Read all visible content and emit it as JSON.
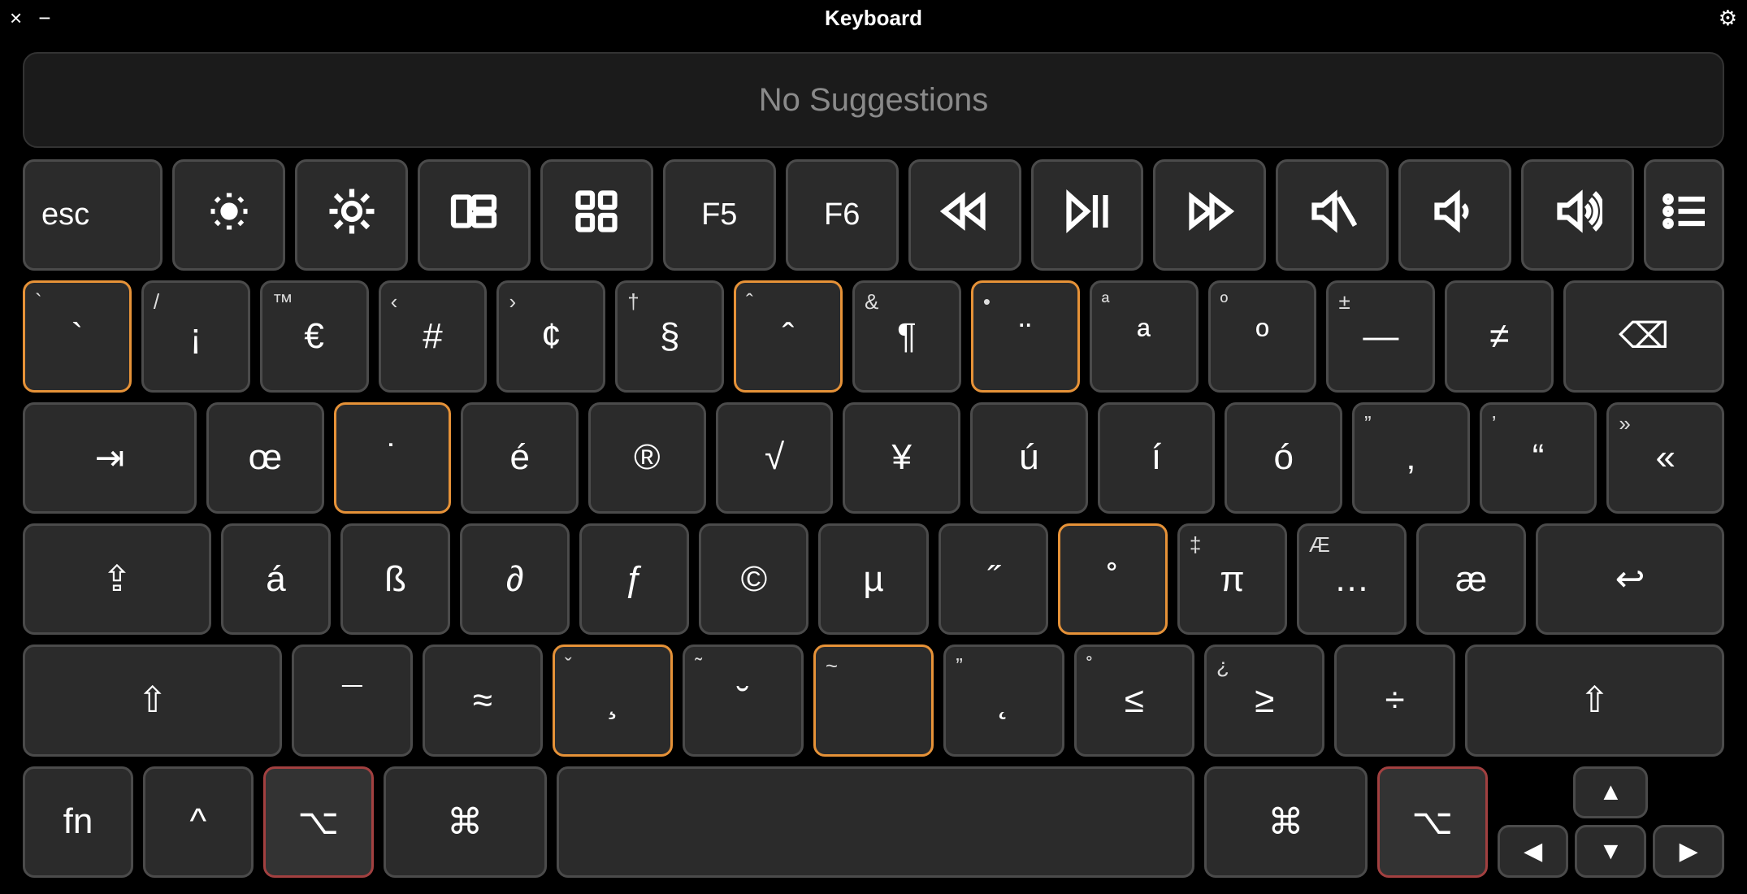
{
  "titlebar": {
    "close": "×",
    "minimize": "−",
    "title": "Keyboard",
    "settings": "⚙"
  },
  "suggestions_text": "No Suggestions",
  "fn_row": [
    {
      "id": "esc",
      "label": "esc",
      "icon": null
    },
    {
      "id": "brightness-down",
      "label": "",
      "icon": "brightness-low"
    },
    {
      "id": "brightness-up",
      "label": "",
      "icon": "brightness-high"
    },
    {
      "id": "mission-control",
      "label": "",
      "icon": "mission-control"
    },
    {
      "id": "launchpad",
      "label": "",
      "icon": "launchpad"
    },
    {
      "id": "f5",
      "label": "F5",
      "icon": null
    },
    {
      "id": "f6",
      "label": "F6",
      "icon": null
    },
    {
      "id": "rewind",
      "label": "",
      "icon": "rewind"
    },
    {
      "id": "play-pause",
      "label": "",
      "icon": "play-pause"
    },
    {
      "id": "fast-forward",
      "label": "",
      "icon": "fast-forward"
    },
    {
      "id": "mute",
      "label": "",
      "icon": "mute"
    },
    {
      "id": "volume-down",
      "label": "",
      "icon": "vol-low"
    },
    {
      "id": "volume-up",
      "label": "",
      "icon": "vol-high"
    },
    {
      "id": "list",
      "label": "",
      "icon": "list"
    }
  ],
  "row1": [
    {
      "id": "backtick",
      "c": "`",
      "tl": "`",
      "hl": "orange"
    },
    {
      "id": "inv-excl",
      "c": "¡",
      "tl": "/"
    },
    {
      "id": "euro",
      "c": "€",
      "tl": "™"
    },
    {
      "id": "hash",
      "c": "#",
      "tl": "‹"
    },
    {
      "id": "cent",
      "c": "¢",
      "tl": "›"
    },
    {
      "id": "section",
      "c": "§",
      "tl": "†"
    },
    {
      "id": "circumflex-dead",
      "c": "ˆ",
      "tl": "ˆ",
      "hl": "orange"
    },
    {
      "id": "pilcrow",
      "c": "¶",
      "tl": "&"
    },
    {
      "id": "diaeresis-dead",
      "c": "¨",
      "tl": "•",
      "hl": "orange"
    },
    {
      "id": "a-ordinal",
      "c": "ª",
      "tl": "ª"
    },
    {
      "id": "o-ordinal",
      "c": "º",
      "tl": "º"
    },
    {
      "id": "em-dash",
      "c": "—",
      "tl": "±"
    },
    {
      "id": "not-equal",
      "c": "≠",
      "tl": ""
    },
    {
      "id": "delete",
      "c": "⌫",
      "tl": "",
      "w": "wide15"
    }
  ],
  "row2": [
    {
      "id": "tab",
      "c": "⇥",
      "tl": "",
      "w": "wide15"
    },
    {
      "id": "oe",
      "c": "œ",
      "tl": ""
    },
    {
      "id": "dot-above-dead",
      "c": "˙",
      "tl": "",
      "hl": "orange"
    },
    {
      "id": "e-acute",
      "c": "é",
      "tl": ""
    },
    {
      "id": "registered",
      "c": "®",
      "tl": ""
    },
    {
      "id": "sqrt",
      "c": "√",
      "tl": ""
    },
    {
      "id": "yen",
      "c": "¥",
      "tl": ""
    },
    {
      "id": "u-acute",
      "c": "ú",
      "tl": ""
    },
    {
      "id": "i-acute",
      "c": "í",
      "tl": ""
    },
    {
      "id": "o-acute",
      "c": "ó",
      "tl": ""
    },
    {
      "id": "comma-quote",
      "c": "‚",
      "tl": "”"
    },
    {
      "id": "open-quote",
      "c": "“",
      "tl": "’"
    },
    {
      "id": "guillemet",
      "c": "«",
      "tl": "»"
    }
  ],
  "row3": [
    {
      "id": "caps-lock",
      "c": "⇪",
      "tl": "",
      "w": "wide175"
    },
    {
      "id": "a-acute",
      "c": "á",
      "tl": ""
    },
    {
      "id": "sharp-s",
      "c": "ß",
      "tl": ""
    },
    {
      "id": "eth-partial",
      "c": "∂",
      "tl": ""
    },
    {
      "id": "florin",
      "c": "ƒ",
      "tl": ""
    },
    {
      "id": "copyright",
      "c": "©",
      "tl": ""
    },
    {
      "id": "mu",
      "c": "µ",
      "tl": ""
    },
    {
      "id": "double-acute",
      "c": "˝",
      "tl": ""
    },
    {
      "id": "ring-above-dead",
      "c": "˚",
      "tl": "",
      "hl": "orange"
    },
    {
      "id": "pi",
      "c": "π",
      "tl": "‡"
    },
    {
      "id": "ellipsis",
      "c": "…",
      "tl": "Æ"
    },
    {
      "id": "ae",
      "c": "æ",
      "tl": ""
    },
    {
      "id": "return",
      "c": "↩",
      "tl": "",
      "w": "wide175"
    }
  ],
  "row4": [
    {
      "id": "shift-left",
      "c": "⇧",
      "tl": "",
      "w": "wide22"
    },
    {
      "id": "macron",
      "c": "¯",
      "tl": ""
    },
    {
      "id": "approx",
      "c": "≈",
      "tl": ""
    },
    {
      "id": "cedilla-dead",
      "c": "¸",
      "tl": "ˇ",
      "hl": "orange"
    },
    {
      "id": "breve",
      "c": "˘",
      "tl": "˜"
    },
    {
      "id": "tilde-dead",
      "c": "",
      "tl": "~",
      "hl": "orange"
    },
    {
      "id": "ogonek",
      "c": "˛",
      "tl": "”"
    },
    {
      "id": "lte",
      "c": "≤",
      "tl": "˚"
    },
    {
      "id": "gte",
      "c": "≥",
      "tl": "¿"
    },
    {
      "id": "division",
      "c": "÷",
      "tl": ""
    },
    {
      "id": "shift-right",
      "c": "⇧",
      "tl": "",
      "w": "wide22"
    }
  ],
  "row5": {
    "left": [
      {
        "id": "fn",
        "c": "fn"
      },
      {
        "id": "control",
        "c": "^"
      },
      {
        "id": "option-left",
        "c": "⌥",
        "hl": "red"
      },
      {
        "id": "command-left",
        "c": "⌘",
        "w": "wide15"
      }
    ],
    "right": [
      {
        "id": "command-right",
        "c": "⌘",
        "w": "wide15"
      },
      {
        "id": "option-right",
        "c": "⌥",
        "hl": "red"
      }
    ],
    "arrows": {
      "up": "▲",
      "left": "◀",
      "down": "▼",
      "right": "▶"
    }
  }
}
